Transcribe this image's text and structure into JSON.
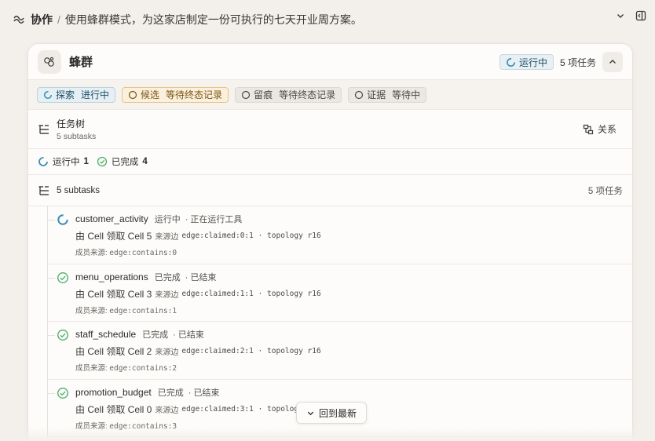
{
  "topbar": {
    "root": "协作",
    "separator": "/",
    "title": "使用蜂群模式，为这家店制定一份可执行的七天开业周方案。"
  },
  "card": {
    "title": "蜂群",
    "status": "运行中",
    "task_count": "5 项任务"
  },
  "phases": [
    {
      "label": "探索",
      "state": "进行中"
    },
    {
      "label": "候选",
      "state": "等待终态记录"
    },
    {
      "label": "留痕",
      "state": "等待终态记录"
    },
    {
      "label": "证据",
      "state": "等待中"
    }
  ],
  "task_tree": {
    "title": "任务树",
    "subtitle": "5 subtasks",
    "relation_label": "关系"
  },
  "summary": {
    "running_label": "运行中",
    "running_count": "1",
    "done_label": "已完成",
    "done_count": "4"
  },
  "subhead": {
    "label": "5 subtasks",
    "right": "5 项任务"
  },
  "tasks": [
    {
      "name": "customer_activity",
      "state": "运行中",
      "detail": "· 正在运行工具",
      "claim": "由 Cell 领取 Cell 5",
      "source_label": "来源边",
      "source": "edge:claimed:0:1 · topology r16",
      "member_label": "成员来源:",
      "member": "edge:contains:0"
    },
    {
      "name": "menu_operations",
      "state": "已完成",
      "detail": "· 已结束",
      "claim": "由 Cell 领取 Cell 3",
      "source_label": "来源边",
      "source": "edge:claimed:1:1 · topology r16",
      "member_label": "成员来源:",
      "member": "edge:contains:1"
    },
    {
      "name": "staff_schedule",
      "state": "已完成",
      "detail": "· 已结束",
      "claim": "由 Cell 领取 Cell 2",
      "source_label": "来源边",
      "source": "edge:claimed:2:1 · topology r16",
      "member_label": "成员来源:",
      "member": "edge:contains:2"
    },
    {
      "name": "promotion_budget",
      "state": "已完成",
      "detail": "· 已结束",
      "claim": "由 Cell 领取 Cell 0",
      "source_label": "来源边",
      "source": "edge:claimed:3:1 · topology r16",
      "member_label": "成员来源:",
      "member": "edge:contains:3"
    }
  ],
  "latest_button": "回到最新",
  "colors": {
    "running": "#3b8fb5",
    "done": "#4caf6a",
    "candidate": "#c48a1d"
  }
}
